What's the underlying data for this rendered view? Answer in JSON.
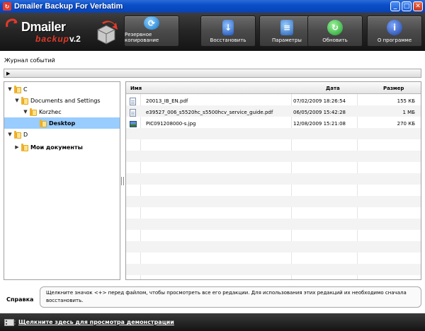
{
  "window": {
    "title": "Dmailer Backup For Verbatim",
    "controls": [
      "_",
      "□",
      "✕"
    ]
  },
  "logo": {
    "brand": "Dmailer",
    "sub": "backup",
    "version": "v.2"
  },
  "toolbar": [
    {
      "label": "Резервное копирование",
      "icon": "backup-icon",
      "glyph": "⟳"
    },
    {
      "label": "Восстановить",
      "icon": "restore-icon",
      "glyph": "↓"
    },
    {
      "label": "Параметры",
      "icon": "settings-icon",
      "glyph": "≡"
    },
    {
      "label": "Обновить",
      "icon": "update-icon",
      "glyph": "↻"
    },
    {
      "label": "О программе",
      "icon": "info-icon",
      "glyph": "i"
    }
  ],
  "event_log": {
    "label": "Журнал событий",
    "expander": "▶"
  },
  "tree": [
    {
      "label": "C",
      "depth": 0,
      "expander": "▼",
      "selected": false,
      "bold": false
    },
    {
      "label": "Documents and Settings",
      "depth": 1,
      "expander": "▼",
      "selected": false,
      "bold": false
    },
    {
      "label": "Korzhec",
      "depth": 2,
      "expander": "▼",
      "selected": false,
      "bold": false
    },
    {
      "label": "Desktop",
      "depth": 3,
      "expander": "",
      "selected": true,
      "bold": true
    },
    {
      "label": "D",
      "depth": 0,
      "expander": "▼",
      "selected": false,
      "bold": false
    },
    {
      "label": "Мои документы",
      "depth": 1,
      "expander": "▶",
      "selected": false,
      "bold": true
    }
  ],
  "files": {
    "headers": {
      "name": "Имя",
      "date": "Дата",
      "size": "Размер"
    },
    "rows": [
      {
        "name": "20013_IB_EN.pdf",
        "date": "07/02/2009 18:26:54",
        "size": "155 КБ",
        "icon": "document-icon"
      },
      {
        "name": "e39527_006_s5520hc_s5500hcv_service_guide.pdf",
        "date": "06/05/2009 15:42:28",
        "size": "1 МБ",
        "icon": "document-icon"
      },
      {
        "name": "PIC091208000-s.jpg",
        "date": "12/08/2009 15:21:08",
        "size": "270 КБ",
        "icon": "image-icon"
      }
    ]
  },
  "help": {
    "label": "Справка",
    "text": "Щелкните значок <+> перед файлом, чтобы просмотреть все его редакции. Для использования этих редакций их необходимо сначала восстановить."
  },
  "footer": {
    "demo_link": "Щелкните здесь для просмотра демонстрации"
  },
  "colors": {
    "titlebar": "#0a4ec7",
    "header": "#262626",
    "selection": "#99ccff",
    "accent": "#e23a2a"
  }
}
